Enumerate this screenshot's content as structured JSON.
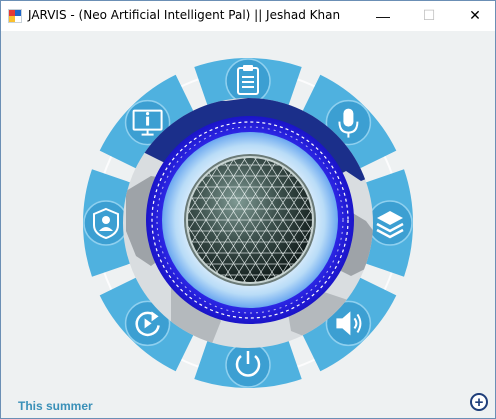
{
  "window": {
    "title": "JARVIS - (Neo Artificial Intelligent Pal) || Jeshad Khan",
    "minimize_symbol": "—",
    "maximize_symbol": "☐",
    "close_symbol": "✕"
  },
  "menu": {
    "items": [
      {
        "name": "notes",
        "icon": "clipboard-icon"
      },
      {
        "name": "microphone",
        "icon": "microphone-icon"
      },
      {
        "name": "layers",
        "icon": "stack-icon"
      },
      {
        "name": "volume",
        "icon": "speaker-icon"
      },
      {
        "name": "power",
        "icon": "power-icon"
      },
      {
        "name": "refresh",
        "icon": "refresh-icon"
      },
      {
        "name": "security",
        "icon": "user-shield-icon"
      },
      {
        "name": "info",
        "icon": "info-monitor-icon"
      }
    ],
    "segment_color": "#4fb1df",
    "icon_circle_color": "#3c9fd2"
  },
  "footer": {
    "label": "This summer",
    "add_symbol": "+"
  },
  "colors": {
    "accent": "#4fb1df",
    "ring_blue": "#2a22e0",
    "globe_navy": "#1b2f8a"
  }
}
